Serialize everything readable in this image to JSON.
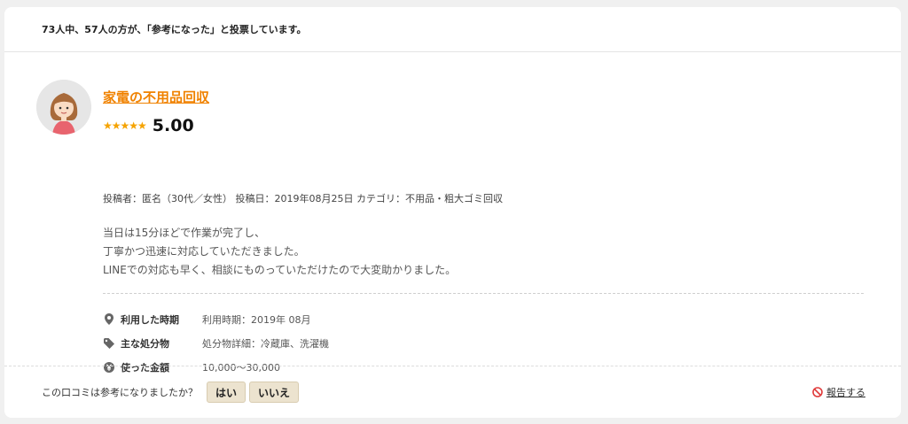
{
  "vote_summary": "73人中、57人の方が、「参考になった」と投票しています。",
  "review": {
    "title": "家電の不用品回収",
    "stars": "★★★★★",
    "score": "5.00",
    "meta": "投稿者：匿名（30代／女性） 投稿日：2019年08月25日 カテゴリ：不用品・粗大ゴミ回収",
    "body": [
      "当日は15分ほどで作業が完了し、",
      "丁寧かつ迅速に対応していただきました。",
      "LINEでの対応も早く、相談にものっていただけたので大変助かりました。"
    ],
    "details": [
      {
        "icon": "location-pin-icon",
        "label": "利用した時期",
        "value": "利用時期：2019年 08月"
      },
      {
        "icon": "tag-icon",
        "label": "主な処分物",
        "value": "処分物詳細：冷蔵庫、洗濯機"
      },
      {
        "icon": "yen-icon",
        "label": "使った金額",
        "value": "10,000〜30,000"
      }
    ]
  },
  "footer": {
    "question": "この口コミは参考になりましたか？",
    "yes_label": "はい",
    "no_label": "いいえ",
    "report_label": "報告する"
  },
  "colors": {
    "accent": "#f08200",
    "star": "#f5a300",
    "button_bg": "#ece3cf",
    "report_icon": "#e03c3c"
  }
}
